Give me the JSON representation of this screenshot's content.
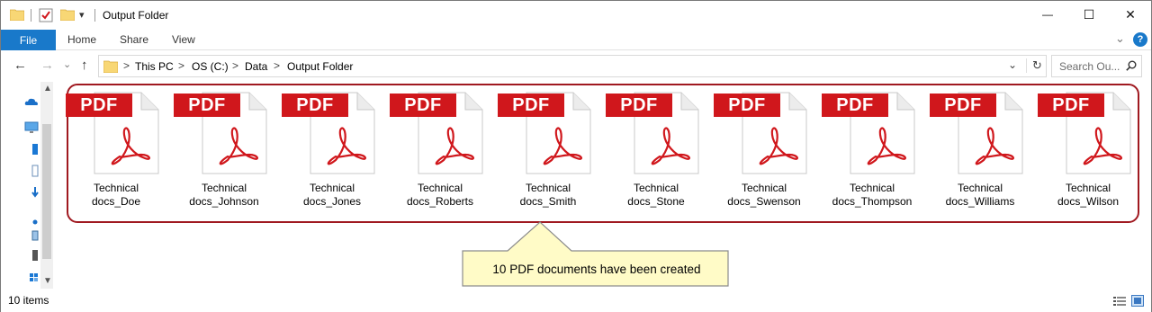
{
  "window": {
    "title": "Output Folder",
    "minimize_glyph": "—",
    "maximize_glyph": "☐",
    "close_glyph": "✕"
  },
  "ribbon": {
    "tabs": [
      "File",
      "Home",
      "Share",
      "View"
    ],
    "help_glyph": "?",
    "expand_glyph": "⌄"
  },
  "address": {
    "back_glyph": "←",
    "forward_glyph": "→",
    "recent_glyph": "⌄",
    "up_glyph": "↑",
    "breadcrumb": [
      "This PC",
      "OS (C:)",
      "Data",
      "Output Folder"
    ],
    "separator": ">",
    "dropdown_glyph": "⌄",
    "refresh_glyph": "↻"
  },
  "search": {
    "placeholder": "Search Ou...",
    "icon": "search-icon"
  },
  "files": [
    {
      "line1": "Technical",
      "line2": "docs_Doe"
    },
    {
      "line1": "Technical",
      "line2": "docs_Johnson"
    },
    {
      "line1": "Technical",
      "line2": "docs_Jones"
    },
    {
      "line1": "Technical",
      "line2": "docs_Roberts"
    },
    {
      "line1": "Technical",
      "line2": "docs_Smith"
    },
    {
      "line1": "Technical",
      "line2": "docs_Stone"
    },
    {
      "line1": "Technical",
      "line2": "docs_Swenson"
    },
    {
      "line1": "Technical",
      "line2": "docs_Thompson"
    },
    {
      "line1": "Technical",
      "line2": "docs_Williams"
    },
    {
      "line1": "Technical",
      "line2": "docs_Wilson"
    }
  ],
  "file_badge": "PDF",
  "callout": {
    "text": "10 PDF documents  have been created"
  },
  "status": {
    "item_count": "10 items"
  },
  "colors": {
    "accent": "#1979ca",
    "pdf_red": "#d0171c",
    "highlight_border": "#a01920",
    "callout_fill": "#fffbc7",
    "folder_yellow": "#f8d775"
  }
}
